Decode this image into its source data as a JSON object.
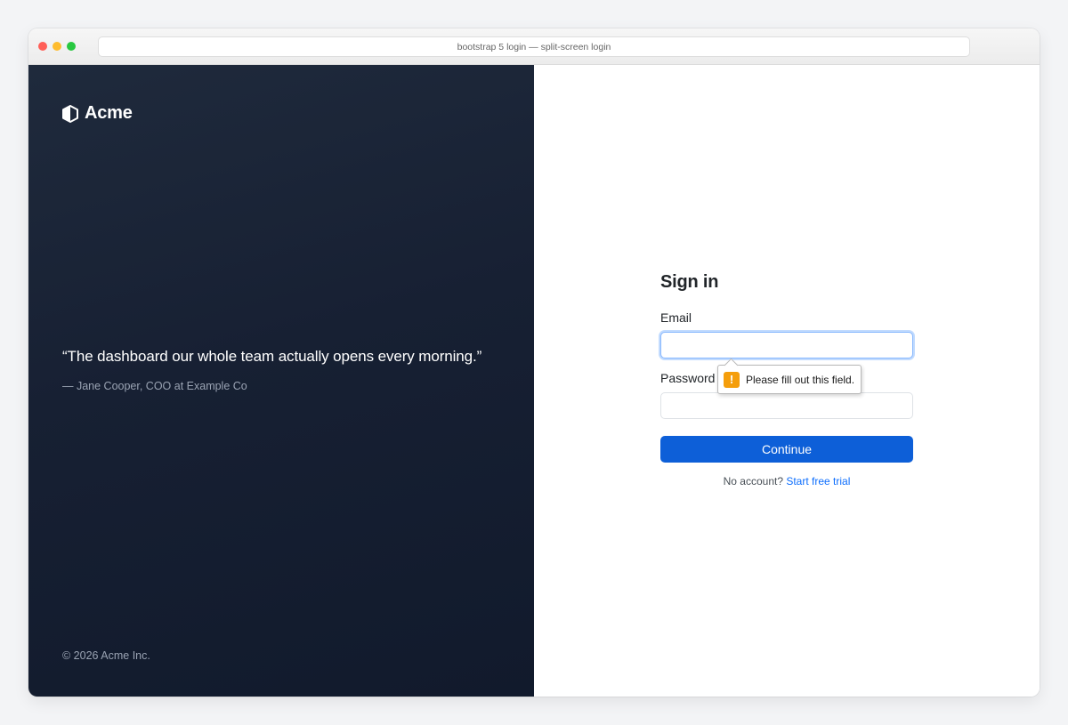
{
  "browser": {
    "address": "bootstrap 5 login — split-screen login"
  },
  "brand": {
    "name": "Acme",
    "icon": "hexagon-shield-icon"
  },
  "testimonial": {
    "quote": "“The dashboard our whole team actually opens every morning.”",
    "attribution": "— Jane Cooper, COO at Example Co"
  },
  "footer": {
    "copyright": "© 2026 Acme Inc."
  },
  "form": {
    "heading": "Sign in",
    "email_label": "Email",
    "email_value": "",
    "password_label": "Password",
    "password_value": "",
    "submit_label": "Continue",
    "signup_prompt": "No account?",
    "signup_link": "Start free trial"
  },
  "validation": {
    "message": "Please fill out this field.",
    "icon": "warning-icon",
    "icon_glyph": "!"
  },
  "colors": {
    "left_panel": "#172033",
    "primary": "#0d5fd8",
    "link": "#0d6efd",
    "warning": "#f59e0b"
  }
}
